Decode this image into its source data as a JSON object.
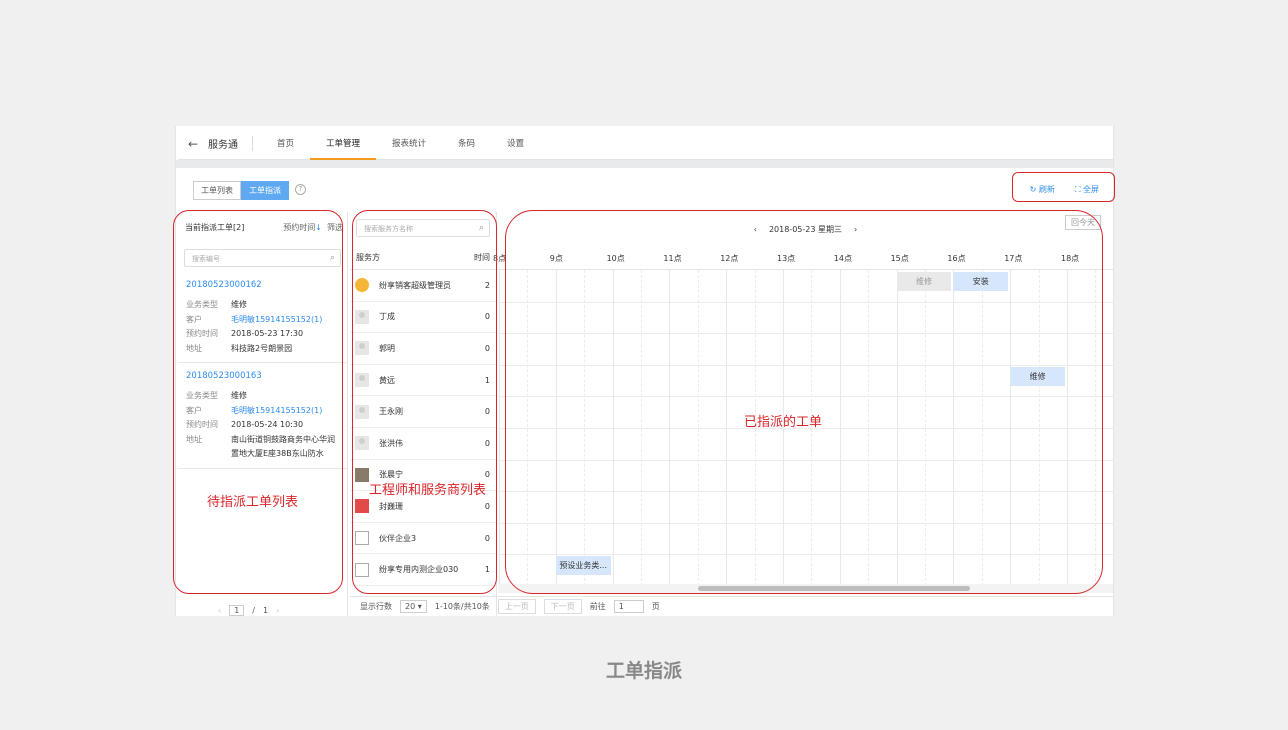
{
  "header": {
    "back_icon": "arrow-left-icon",
    "app_title": "服务通",
    "nav": [
      "首页",
      "工单管理",
      "报表统计",
      "条码",
      "设置"
    ],
    "active_nav": "工单管理"
  },
  "toolbar": {
    "tab_list": "工单列表",
    "tab_dispatch": "工单指派",
    "help_icon": "?",
    "refresh_icon": "↻",
    "refresh_label": "刷新",
    "fullscreen_icon": "⛶",
    "fullscreen_label": "全屏"
  },
  "pending": {
    "title": "当前指派工单[2]",
    "sort_label": "预约时间",
    "sort_icon": "↓",
    "filter_label": "筛选",
    "search_placeholder": "搜索编号",
    "orders": [
      {
        "no": "20180523000162",
        "type_label": "业务类型",
        "type": "维修",
        "customer_label": "客户",
        "customer": "毛明敏15914155152(1)",
        "time_label": "预约时间",
        "time": "2018-05-23 17:30",
        "addr_label": "地址",
        "addr": "科技路2号朗景园"
      },
      {
        "no": "20180523000163",
        "type_label": "业务类型",
        "type": "维修",
        "customer_label": "客户",
        "customer": "毛明敏15914155152(1)",
        "time_label": "预约时间",
        "time": "2018-05-24 10:30",
        "addr_label": "地址",
        "addr": "南山街道铜鼓路商务中心华润置地大厦E座38B东山防水"
      }
    ],
    "pager": {
      "prev": "‹",
      "page": "1",
      "sep": "/",
      "total": "1",
      "next": "›"
    }
  },
  "providers": {
    "search_placeholder": "搜索服务方名称",
    "col_name": "服务方",
    "col_time": "时间",
    "rows": [
      {
        "name": "纷享销客超级管理员",
        "count": "2",
        "avatar": "face"
      },
      {
        "name": "丁成",
        "count": "0",
        "avatar": "user"
      },
      {
        "name": "郭明",
        "count": "0",
        "avatar": "user"
      },
      {
        "name": "黄远",
        "count": "1",
        "avatar": "user"
      },
      {
        "name": "王永刚",
        "count": "0",
        "avatar": "user"
      },
      {
        "name": "张洪伟",
        "count": "0",
        "avatar": "user"
      },
      {
        "name": "张晨宁",
        "count": "0",
        "avatar": "photo"
      },
      {
        "name": "封巍珊",
        "count": "0",
        "avatar": "red"
      },
      {
        "name": "伙伴企业3",
        "count": "0",
        "avatar": "building"
      },
      {
        "name": "纷享专用内测企业030",
        "count": "1",
        "avatar": "building"
      }
    ]
  },
  "schedule": {
    "prev_icon": "‹",
    "date": "2018-05-23 星期三",
    "next_icon": "›",
    "today_btn": "回今天",
    "hours": [
      "8点",
      "9点",
      "10点",
      "11点",
      "12点",
      "13点",
      "14点",
      "15点",
      "16点",
      "17点",
      "18点"
    ],
    "tasks": [
      {
        "label": "维修",
        "row": 0,
        "start": 15,
        "end": 16,
        "style": "gray"
      },
      {
        "label": "安装",
        "row": 0,
        "start": 16,
        "end": 17,
        "style": "blue"
      },
      {
        "label": "维修",
        "row": 3,
        "start": 17,
        "end": 18,
        "style": "blue"
      },
      {
        "label": "预设业务类...",
        "row": 9,
        "start": 9,
        "end": 10,
        "style": "blue"
      }
    ]
  },
  "footer": {
    "rows_label": "显示行数",
    "rows_value": "20",
    "range": "1-10条/共10条",
    "prev_btn": "上一页",
    "next_btn": "下一页",
    "goto_label": "前往",
    "goto_value": "1",
    "page_unit": "页"
  },
  "annotations": {
    "pending_list": "待指派工单列表",
    "provider_list": "工程师和服务商列表",
    "assigned": "已指派的工单"
  },
  "caption": "工单指派",
  "colors": {
    "accent": "#2d8cf0",
    "annotation": "#d9262b",
    "active_tab": "#f39a1e"
  }
}
